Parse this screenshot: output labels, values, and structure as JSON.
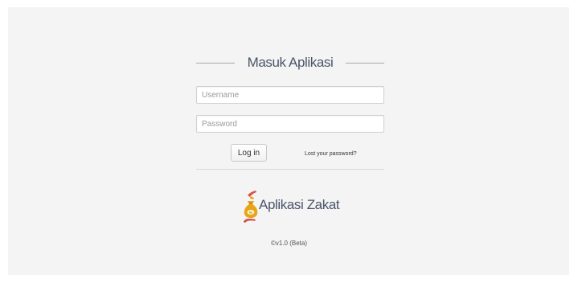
{
  "login": {
    "heading": "Masuk Aplikasi",
    "username_placeholder": "Username",
    "password_placeholder": "Password",
    "username_value": "",
    "password_value": "",
    "login_button": "Log in",
    "lost_password_link": "Lost your password?"
  },
  "brand": {
    "name": "Aplikasi Zakat",
    "logo_icon": "money-bag-hands-icon",
    "logo_colors": {
      "bag": "#e8a317",
      "hands": "#d9534f",
      "label": "#fff6cc"
    }
  },
  "footer": {
    "version": "©v1.0 (Beta)"
  }
}
